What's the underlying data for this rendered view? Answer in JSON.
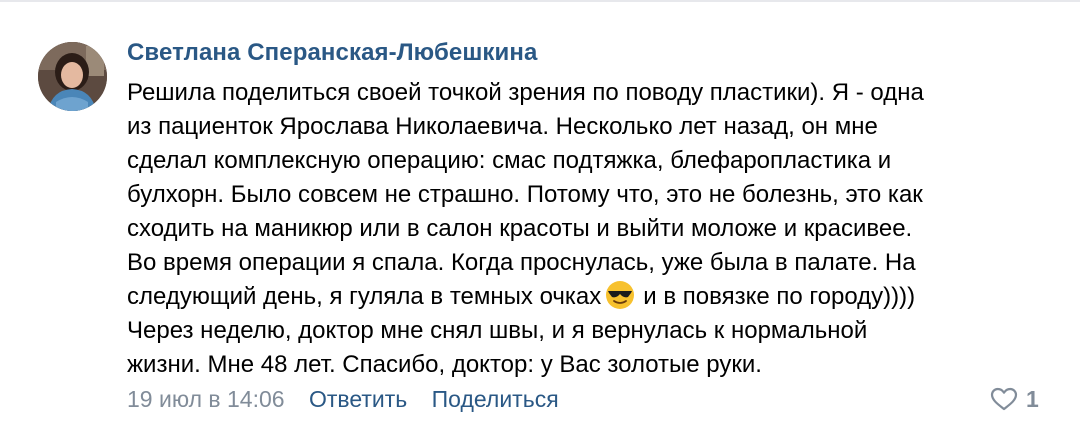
{
  "comment": {
    "author": "Светлана Сперанская-Любешкина",
    "text_lines": [
      "Решила поделиться своей точкой зрения по поводу пластики). Я - одна",
      "из пациенток Ярослава Николаевича. Несколько лет назад, он мне",
      "сделал комплексную операцию: смас подтяжка, блефаропластика и",
      "булхорн. Было совсем не страшно. Потому что, это не болезнь, это как",
      "сходить на маникюр или в салон красоты и выйти моложе и красивее.",
      "Во время операции я спала. Когда проснулась, уже была в палате. На",
      "следующий день, я гуляла в темных очках",
      "и в повязке по городу))))",
      "Через неделю, доктор мне снял швы, и я вернулась к нормальной",
      "жизни. Мне 48 лет. Спасибо, доктор: у Вас золотые руки."
    ],
    "emoji": "sunglasses-emoji",
    "date": "19 июл в 14:06",
    "reply_label": "Ответить",
    "share_label": "Поделиться",
    "likes_count": "1"
  },
  "colors": {
    "link": "#2a5885",
    "meta": "#818c99",
    "text": "#000000"
  }
}
